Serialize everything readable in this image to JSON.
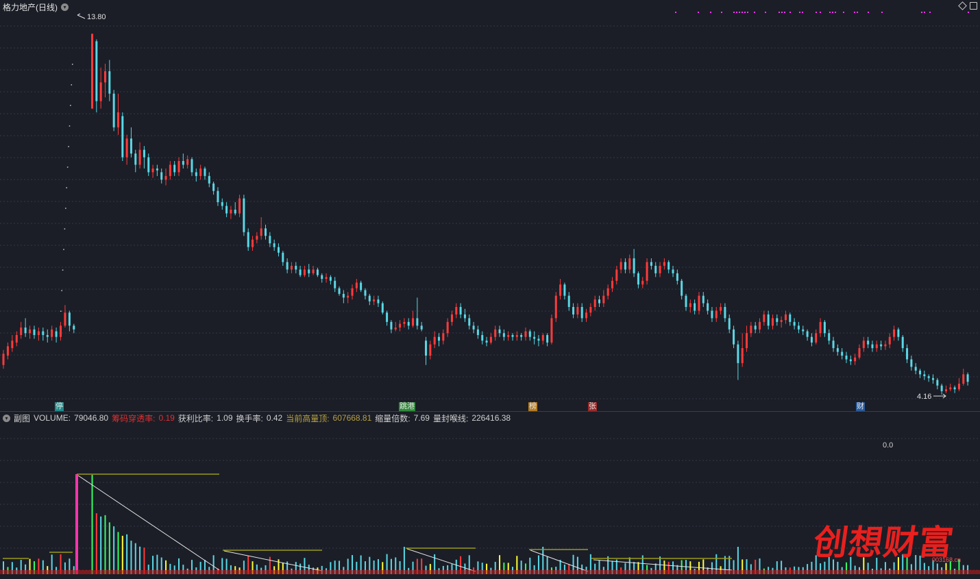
{
  "header": {
    "title": "格力地产(日线)"
  },
  "price_chart": {
    "high_label": "13.80",
    "low_label": "4.16",
    "ylim": [
      3.9,
      14.3
    ],
    "colors": {
      "up": "#ff3b3b",
      "down": "#5ad8e6",
      "grid": "#323846",
      "bg": "#1b1e27"
    },
    "candles": [
      [
        4.95,
        5.25,
        5.35,
        4.85
      ],
      [
        5.2,
        5.45,
        5.55,
        5.1
      ],
      [
        5.4,
        5.6,
        5.75,
        5.3
      ],
      [
        5.55,
        5.75,
        5.85,
        5.45
      ],
      [
        5.75,
        5.95,
        6.1,
        5.65
      ],
      [
        5.95,
        5.8,
        6.2,
        5.7
      ],
      [
        5.8,
        5.9,
        6.0,
        5.65
      ],
      [
        5.9,
        5.75,
        6.0,
        5.65
      ],
      [
        5.75,
        5.85,
        5.95,
        5.6
      ],
      [
        5.85,
        5.75,
        5.95,
        5.6
      ],
      [
        5.75,
        5.7,
        5.9,
        5.55
      ],
      [
        5.7,
        5.9,
        6.0,
        5.6
      ],
      [
        5.85,
        5.7,
        5.95,
        5.55
      ],
      [
        5.7,
        6.0,
        6.1,
        5.6
      ],
      [
        6.0,
        6.35,
        6.55,
        5.95
      ],
      [
        6.35,
        6.0,
        6.4,
        5.85
      ],
      [
        6.0,
        5.9,
        6.05,
        5.8
      ],
      [
        11.8,
        13.8,
        13.8,
        11.8
      ],
      [
        13.6,
        12.0,
        13.65,
        11.7
      ],
      [
        12.0,
        12.5,
        12.9,
        11.8
      ],
      [
        12.5,
        12.8,
        13.0,
        12.1
      ],
      [
        12.8,
        12.2,
        13.1,
        12.0
      ],
      [
        12.2,
        11.3,
        12.3,
        11.2
      ],
      [
        11.3,
        11.7,
        12.2,
        11.1
      ],
      [
        11.6,
        10.5,
        11.7,
        10.4
      ],
      [
        10.5,
        11.0,
        11.1,
        10.3
      ],
      [
        11.0,
        10.6,
        11.3,
        10.5
      ],
      [
        10.6,
        10.3,
        10.7,
        10.1
      ],
      [
        10.3,
        10.7,
        10.9,
        10.2
      ],
      [
        10.7,
        10.5,
        10.8,
        10.2
      ],
      [
        10.5,
        10.1,
        10.6,
        10.0
      ],
      [
        10.1,
        10.2,
        10.3,
        9.95
      ],
      [
        10.2,
        10.15,
        10.3,
        10.0
      ],
      [
        10.1,
        9.9,
        10.2,
        9.8
      ],
      [
        9.9,
        10.0,
        10.2,
        9.75
      ],
      [
        10.0,
        10.3,
        10.4,
        9.9
      ],
      [
        10.3,
        10.1,
        10.4,
        10.0
      ],
      [
        10.1,
        10.4,
        10.5,
        10.0
      ],
      [
        10.4,
        10.3,
        10.6,
        10.2
      ],
      [
        10.3,
        10.45,
        10.55,
        10.2
      ],
      [
        10.45,
        10.1,
        10.5,
        10.0
      ],
      [
        10.1,
        10.0,
        10.2,
        9.85
      ],
      [
        10.0,
        10.2,
        10.3,
        9.9
      ],
      [
        10.2,
        10.0,
        10.25,
        9.9
      ],
      [
        10.0,
        9.8,
        10.1,
        9.7
      ],
      [
        9.8,
        9.6,
        9.85,
        9.5
      ],
      [
        9.6,
        9.3,
        9.7,
        9.2
      ],
      [
        9.3,
        9.2,
        9.4,
        9.1
      ],
      [
        9.2,
        9.0,
        9.3,
        8.9
      ],
      [
        9.0,
        9.1,
        9.2,
        8.85
      ],
      [
        9.1,
        9.0,
        9.3,
        8.95
      ],
      [
        9.0,
        9.4,
        9.5,
        8.9
      ],
      [
        9.4,
        8.5,
        9.5,
        8.4
      ],
      [
        8.5,
        8.1,
        8.6,
        8.0
      ],
      [
        8.1,
        8.3,
        8.4,
        8.0
      ],
      [
        8.3,
        8.4,
        8.5,
        8.2
      ],
      [
        8.4,
        8.6,
        8.9,
        8.3
      ],
      [
        8.6,
        8.4,
        8.7,
        8.3
      ],
      [
        8.4,
        8.2,
        8.5,
        8.1
      ],
      [
        8.2,
        8.1,
        8.3,
        8.0
      ],
      [
        8.1,
        7.95,
        8.2,
        7.85
      ],
      [
        7.95,
        7.7,
        8.0,
        7.6
      ],
      [
        7.7,
        7.5,
        7.8,
        7.4
      ],
      [
        7.5,
        7.6,
        7.7,
        7.4
      ],
      [
        7.6,
        7.5,
        7.7,
        7.4
      ],
      [
        7.5,
        7.35,
        7.6,
        7.3
      ],
      [
        7.35,
        7.5,
        7.6,
        7.3
      ],
      [
        7.5,
        7.4,
        7.65,
        7.3
      ],
      [
        7.4,
        7.5,
        7.6,
        7.35
      ],
      [
        7.5,
        7.35,
        7.55,
        7.3
      ],
      [
        7.35,
        7.25,
        7.4,
        7.15
      ],
      [
        7.25,
        7.3,
        7.4,
        7.15
      ],
      [
        7.3,
        7.2,
        7.35,
        7.1
      ],
      [
        7.2,
        7.0,
        7.3,
        6.9
      ],
      [
        7.0,
        6.85,
        7.05,
        6.8
      ],
      [
        6.85,
        6.75,
        6.95,
        6.6
      ],
      [
        6.75,
        6.8,
        6.9,
        6.6
      ],
      [
        6.8,
        7.0,
        7.1,
        6.7
      ],
      [
        7.0,
        7.15,
        7.25,
        6.9
      ],
      [
        7.15,
        6.95,
        7.2,
        6.9
      ],
      [
        6.95,
        6.8,
        7.0,
        6.7
      ],
      [
        6.8,
        6.65,
        6.85,
        6.55
      ],
      [
        6.65,
        6.7,
        6.8,
        6.55
      ],
      [
        6.7,
        6.6,
        6.8,
        6.5
      ],
      [
        6.6,
        6.35,
        6.65,
        6.3
      ],
      [
        6.35,
        6.1,
        6.4,
        6.0
      ],
      [
        6.1,
        5.9,
        6.15,
        5.8
      ],
      [
        5.9,
        5.95,
        6.1,
        5.85
      ],
      [
        5.95,
        6.05,
        6.15,
        5.85
      ],
      [
        6.05,
        6.1,
        6.2,
        5.95
      ],
      [
        6.1,
        6.0,
        6.2,
        5.9
      ],
      [
        6.0,
        6.2,
        6.4,
        5.95
      ],
      [
        6.2,
        6.0,
        6.75,
        5.9
      ],
      [
        6.0,
        5.9,
        6.1,
        5.85
      ],
      [
        5.6,
        5.2,
        5.7,
        4.95
      ],
      [
        5.2,
        5.5,
        5.6,
        5.1
      ],
      [
        5.5,
        5.7,
        5.85,
        5.4
      ],
      [
        5.7,
        5.6,
        5.8,
        5.45
      ],
      [
        5.6,
        5.8,
        5.9,
        5.5
      ],
      [
        5.8,
        6.1,
        6.2,
        5.7
      ],
      [
        6.1,
        6.3,
        6.4,
        6.0
      ],
      [
        6.3,
        6.5,
        6.6,
        6.2
      ],
      [
        6.5,
        6.3,
        6.6,
        6.2
      ],
      [
        6.3,
        6.2,
        6.45,
        6.1
      ],
      [
        6.2,
        6.0,
        6.3,
        5.9
      ],
      [
        6.0,
        5.9,
        6.1,
        5.8
      ],
      [
        5.9,
        5.75,
        6.0,
        5.65
      ],
      [
        5.75,
        5.6,
        5.85,
        5.5
      ],
      [
        5.6,
        5.55,
        5.7,
        5.45
      ],
      [
        5.55,
        5.7,
        5.8,
        5.5
      ],
      [
        5.7,
        5.9,
        6.0,
        5.6
      ],
      [
        5.9,
        5.8,
        6.0,
        5.7
      ],
      [
        5.8,
        5.7,
        5.9,
        5.6
      ],
      [
        5.7,
        5.75,
        5.85,
        5.6
      ],
      [
        5.75,
        5.7,
        5.8,
        5.6
      ],
      [
        5.7,
        5.75,
        5.85,
        5.6
      ],
      [
        5.75,
        5.7,
        5.8,
        5.6
      ],
      [
        5.7,
        5.85,
        5.95,
        5.6
      ],
      [
        5.85,
        5.7,
        5.9,
        5.6
      ],
      [
        5.7,
        5.65,
        5.85,
        5.5
      ],
      [
        5.65,
        5.6,
        5.75,
        5.45
      ],
      [
        5.6,
        5.75,
        5.8,
        5.5
      ],
      [
        5.75,
        5.55,
        5.8,
        5.45
      ],
      [
        5.55,
        6.2,
        6.3,
        5.5
      ],
      [
        6.2,
        6.8,
        6.9,
        6.1
      ],
      [
        6.8,
        7.1,
        7.25,
        6.7
      ],
      [
        7.1,
        6.8,
        7.15,
        6.7
      ],
      [
        6.8,
        6.5,
        6.9,
        6.4
      ],
      [
        6.5,
        6.3,
        6.6,
        6.2
      ],
      [
        6.3,
        6.5,
        6.6,
        6.2
      ],
      [
        6.5,
        6.2,
        6.6,
        6.1
      ],
      [
        6.2,
        6.35,
        6.45,
        6.1
      ],
      [
        6.35,
        6.5,
        6.6,
        6.25
      ],
      [
        6.5,
        6.7,
        6.8,
        6.4
      ],
      [
        6.7,
        6.6,
        6.8,
        6.5
      ],
      [
        6.6,
        6.8,
        6.95,
        6.5
      ],
      [
        6.8,
        7.0,
        7.1,
        6.7
      ],
      [
        7.0,
        7.2,
        7.3,
        6.9
      ],
      [
        7.2,
        7.5,
        7.6,
        7.1
      ],
      [
        7.5,
        7.7,
        7.8,
        7.4
      ],
      [
        7.7,
        7.5,
        7.8,
        7.4
      ],
      [
        7.5,
        7.8,
        7.9,
        7.4
      ],
      [
        7.8,
        7.4,
        8.05,
        7.3
      ],
      [
        7.4,
        7.1,
        7.45,
        7.0
      ],
      [
        7.1,
        7.2,
        7.3,
        7.0
      ],
      [
        7.2,
        7.7,
        7.8,
        7.1
      ],
      [
        7.7,
        7.6,
        7.8,
        7.5
      ],
      [
        7.6,
        7.4,
        7.7,
        7.3
      ],
      [
        7.4,
        7.6,
        7.7,
        7.3
      ],
      [
        7.6,
        7.7,
        7.8,
        7.5
      ],
      [
        7.7,
        7.5,
        7.75,
        7.4
      ],
      [
        7.5,
        7.4,
        7.6,
        7.3
      ],
      [
        7.4,
        7.2,
        7.5,
        7.1
      ],
      [
        7.2,
        6.8,
        7.25,
        6.7
      ],
      [
        6.8,
        6.5,
        6.85,
        6.4
      ],
      [
        6.5,
        6.6,
        6.7,
        6.35
      ],
      [
        6.6,
        6.4,
        6.7,
        6.3
      ],
      [
        6.4,
        6.8,
        6.9,
        6.3
      ],
      [
        6.8,
        6.6,
        6.9,
        6.5
      ],
      [
        6.6,
        6.4,
        6.7,
        6.3
      ],
      [
        6.4,
        6.2,
        6.5,
        6.1
      ],
      [
        6.2,
        6.4,
        6.5,
        6.1
      ],
      [
        6.4,
        6.5,
        6.6,
        6.3
      ],
      [
        6.5,
        6.2,
        6.6,
        6.1
      ],
      [
        6.2,
        5.9,
        6.3,
        5.8
      ],
      [
        5.9,
        5.5,
        6.0,
        5.4
      ],
      [
        5.5,
        5.0,
        5.6,
        4.55
      ],
      [
        5.0,
        5.4,
        5.8,
        4.9
      ],
      [
        5.4,
        5.8,
        6.0,
        5.3
      ],
      [
        5.8,
        6.0,
        6.1,
        5.7
      ],
      [
        6.0,
        5.9,
        6.1,
        5.8
      ],
      [
        5.9,
        6.1,
        6.2,
        5.8
      ],
      [
        6.1,
        6.3,
        6.4,
        6.0
      ],
      [
        6.3,
        6.0,
        6.4,
        5.9
      ],
      [
        6.0,
        6.2,
        6.3,
        5.9
      ],
      [
        6.2,
        6.1,
        6.3,
        6.0
      ],
      [
        6.1,
        6.15,
        6.25,
        5.95
      ],
      [
        6.15,
        6.3,
        6.4,
        6.05
      ],
      [
        6.3,
        6.1,
        6.35,
        6.0
      ],
      [
        6.1,
        6.0,
        6.2,
        5.9
      ],
      [
        6.0,
        5.9,
        6.1,
        5.8
      ],
      [
        5.9,
        5.85,
        6.0,
        5.75
      ],
      [
        5.85,
        5.7,
        5.9,
        5.6
      ],
      [
        5.7,
        5.55,
        5.8,
        5.45
      ],
      [
        5.55,
        5.8,
        5.9,
        5.5
      ],
      [
        5.8,
        6.1,
        6.2,
        5.7
      ],
      [
        6.1,
        5.8,
        6.15,
        5.7
      ],
      [
        5.8,
        5.6,
        5.9,
        5.5
      ],
      [
        5.6,
        5.4,
        5.7,
        5.3
      ],
      [
        5.4,
        5.3,
        5.5,
        5.2
      ],
      [
        5.3,
        5.2,
        5.4,
        5.1
      ],
      [
        5.2,
        5.1,
        5.3,
        5.0
      ],
      [
        5.1,
        5.05,
        5.2,
        4.95
      ],
      [
        5.05,
        5.15,
        5.25,
        4.95
      ],
      [
        5.15,
        5.4,
        5.5,
        5.1
      ],
      [
        5.4,
        5.6,
        5.7,
        5.3
      ],
      [
        5.6,
        5.5,
        5.7,
        5.4
      ],
      [
        5.5,
        5.4,
        5.6,
        5.3
      ],
      [
        5.4,
        5.5,
        5.6,
        5.3
      ],
      [
        5.5,
        5.45,
        5.6,
        5.35
      ],
      [
        5.45,
        5.5,
        5.6,
        5.35
      ],
      [
        5.5,
        5.7,
        5.8,
        5.4
      ],
      [
        5.7,
        5.9,
        6.0,
        5.6
      ],
      [
        5.9,
        5.7,
        5.95,
        5.6
      ],
      [
        5.7,
        5.4,
        5.75,
        5.3
      ],
      [
        5.4,
        5.1,
        5.5,
        5.0
      ],
      [
        5.1,
        4.9,
        5.2,
        4.8
      ],
      [
        4.9,
        4.8,
        5.0,
        4.7
      ],
      [
        4.8,
        4.7,
        4.85,
        4.6
      ],
      [
        4.7,
        4.65,
        4.8,
        4.55
      ],
      [
        4.65,
        4.6,
        4.7,
        4.5
      ],
      [
        4.6,
        4.55,
        4.7,
        4.45
      ],
      [
        4.55,
        4.4,
        4.6,
        4.3
      ],
      [
        4.4,
        4.25,
        4.45,
        4.16
      ],
      [
        4.25,
        4.3,
        4.4,
        4.2
      ],
      [
        4.3,
        4.35,
        4.45,
        4.25
      ],
      [
        4.35,
        4.3,
        4.4,
        4.2
      ],
      [
        4.3,
        4.45,
        4.6,
        4.25
      ],
      [
        4.45,
        4.7,
        4.85,
        4.4
      ],
      [
        4.7,
        4.5,
        4.75,
        4.4
      ]
    ]
  },
  "sub_chart": {
    "menu_label": "副图",
    "zero_label": "0.0",
    "volume": {
      "label": "VOLUME:",
      "value": "79046.80"
    },
    "chip_penetration": {
      "label": "筹码穿透率:",
      "value": "0.19"
    },
    "profit_ratio": {
      "label": "获利比率:",
      "value": "1.09"
    },
    "turnover": {
      "label": "换手率:",
      "value": "0.42"
    },
    "current_high_volume": {
      "label": "当前高量顶:",
      "value": "607668.81"
    },
    "shrink_multiple": {
      "label": "缩量倍数:",
      "value": "7.69"
    },
    "limit_volume_line": {
      "label": "量封喉线:",
      "value": "226416.38"
    }
  },
  "event_tags": [
    {
      "text": "停",
      "color": "#1f8a8a"
    },
    {
      "text": "跳港",
      "color": "#2e8b3a"
    },
    {
      "text": "榜",
      "color": "#b47a1e"
    },
    {
      "text": "张",
      "color": "#9a2a2a"
    },
    {
      "text": "财",
      "color": "#2a5a9a"
    }
  ],
  "watermark": {
    "text": "创想财富",
    "url": "003168.cn"
  }
}
